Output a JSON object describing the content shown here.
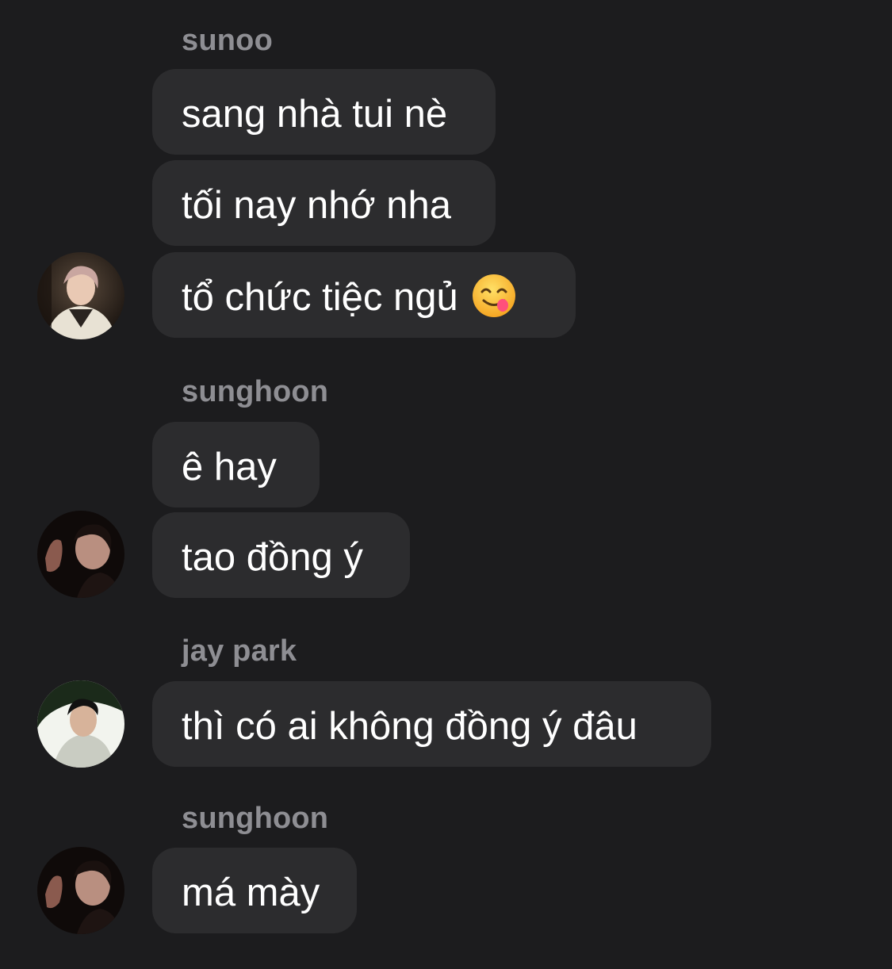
{
  "groups": [
    {
      "sender": "sunoo",
      "avatar": "sunoo-avatar",
      "messages": [
        "sang nhà tui nè",
        "tối nay nhớ nha",
        "tổ chức tiệc ngủ"
      ],
      "emoji": "face-savoring-food-emoji"
    },
    {
      "sender": "sunghoon",
      "avatar": "sunghoon-avatar",
      "messages": [
        "ê hay",
        "tao đồng ý"
      ]
    },
    {
      "sender": "jay park",
      "avatar": "jay-park-avatar",
      "messages": [
        "thì có ai không đồng ý đâu"
      ]
    },
    {
      "sender": "sunghoon",
      "avatar": "sunghoon-avatar",
      "messages": [
        "má mày"
      ]
    }
  ],
  "colors": {
    "background": "#1c1c1e",
    "bubble": "#2c2c2e",
    "sender_name": "#8e8e93",
    "message_text": "#ffffff"
  }
}
